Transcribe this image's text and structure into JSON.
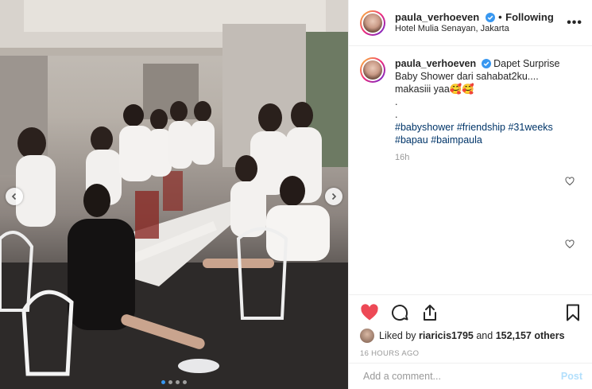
{
  "post": {
    "username": "paula_verhoeven",
    "follow_separator": "•",
    "follow_label": "Following",
    "location": "Hotel Mulia Senayan, Jakarta",
    "more_label": "•••"
  },
  "caption": {
    "username": "paula_verhoeven",
    "text_line1": "Dapet Surprise",
    "text_line2": "Baby Shower dari sahabat2ku....",
    "text_line3": "makasiii yaa🥰🥰",
    "dot1": ".",
    "dot2": ".",
    "hashtags": [
      "#babyshower",
      "#friendship",
      "#31weeks",
      "#bapau",
      "#baimpaula"
    ],
    "time_ago": "16h"
  },
  "likes": {
    "prefix": "Liked by",
    "user": "riaricis1795",
    "and": "and",
    "count": "152,157 others"
  },
  "timestamp": "16 HOURS AGO",
  "comment_box": {
    "placeholder": "Add a comment...",
    "post_label": "Post"
  },
  "carousel": {
    "total": 4,
    "active": 1
  },
  "colors": {
    "like_red": "#ed4956",
    "link_blue": "#003569",
    "verified_blue": "#3897f0",
    "post_disabled": "#b2dffc"
  }
}
